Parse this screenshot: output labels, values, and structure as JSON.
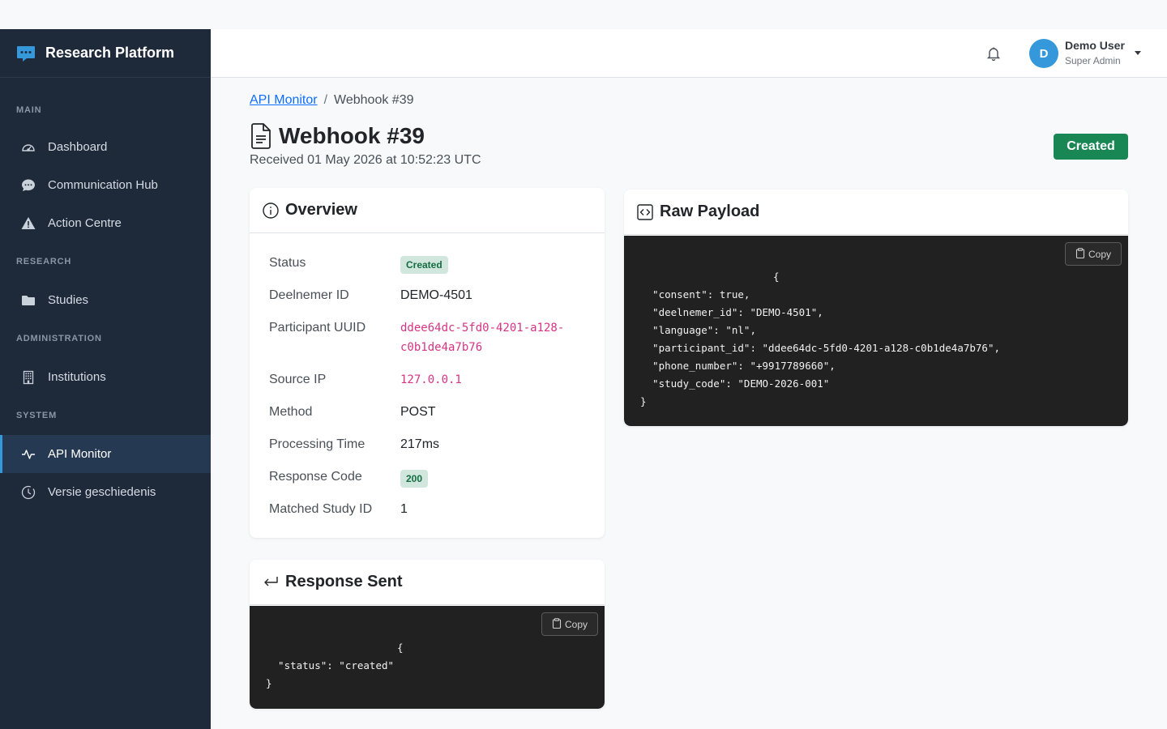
{
  "app": {
    "title": "Research Platform"
  },
  "sidebar": {
    "sections": [
      {
        "label": "MAIN",
        "items": [
          {
            "label": "Dashboard",
            "icon": "speedometer-icon"
          },
          {
            "label": "Communication Hub",
            "icon": "chat-icon"
          },
          {
            "label": "Action Centre",
            "icon": "warning-icon"
          }
        ]
      },
      {
        "label": "RESEARCH",
        "items": [
          {
            "label": "Studies",
            "icon": "folder-icon"
          }
        ]
      },
      {
        "label": "ADMINISTRATION",
        "items": [
          {
            "label": "Institutions",
            "icon": "building-icon"
          }
        ]
      },
      {
        "label": "SYSTEM",
        "items": [
          {
            "label": "API Monitor",
            "icon": "activity-icon",
            "active": true
          },
          {
            "label": "Versie geschiedenis",
            "icon": "clock-history-icon"
          }
        ]
      }
    ]
  },
  "header": {
    "user": {
      "initial": "D",
      "name": "Demo User",
      "role": "Super Admin"
    }
  },
  "breadcrumb": {
    "parent": "API Monitor",
    "separator": "/",
    "current": "Webhook #39"
  },
  "page": {
    "title": "Webhook #39",
    "received": "Received 01 May 2026 at 10:52:23 UTC",
    "status": "Created"
  },
  "overview": {
    "title": "Overview",
    "rows": [
      {
        "label": "Status",
        "value": "Created"
      },
      {
        "label": "Deelnemer ID",
        "value": "DEMO-4501"
      },
      {
        "label": "Participant UUID",
        "value_line1": "ddee64dc-5fd0-4201-a128-",
        "value_line2": "c0b1de4a7b76"
      },
      {
        "label": "Source IP",
        "value": "127.0.0.1"
      },
      {
        "label": "Method",
        "value": "POST"
      },
      {
        "label": "Processing Time",
        "value": "217ms"
      },
      {
        "label": "Response Code",
        "value": "200"
      },
      {
        "label": "Matched Study ID",
        "value": "1"
      }
    ]
  },
  "raw_payload": {
    "title": "Raw Payload",
    "copy_label": "Copy",
    "lines": [
      "{",
      "  \"consent\": true,",
      "  \"deelnemer_id\": \"DEMO-4501\",",
      "  \"language\": \"nl\",",
      "  \"participant_id\": \"ddee64dc-5fd0-4201-a128-c0b1de4a7b76\",",
      "  \"phone_number\": \"+9917789660\",",
      "  \"study_code\": \"DEMO-2026-001\"",
      "}"
    ]
  },
  "response_sent": {
    "title": "Response Sent",
    "copy_label": "Copy",
    "lines": [
      "{",
      "  \"status\": \"created\"",
      "}"
    ]
  },
  "colors": {
    "sidebar_bg": "#1e2a3a",
    "accent": "#3498db",
    "success": "#198754",
    "code_bg": "#212121"
  }
}
